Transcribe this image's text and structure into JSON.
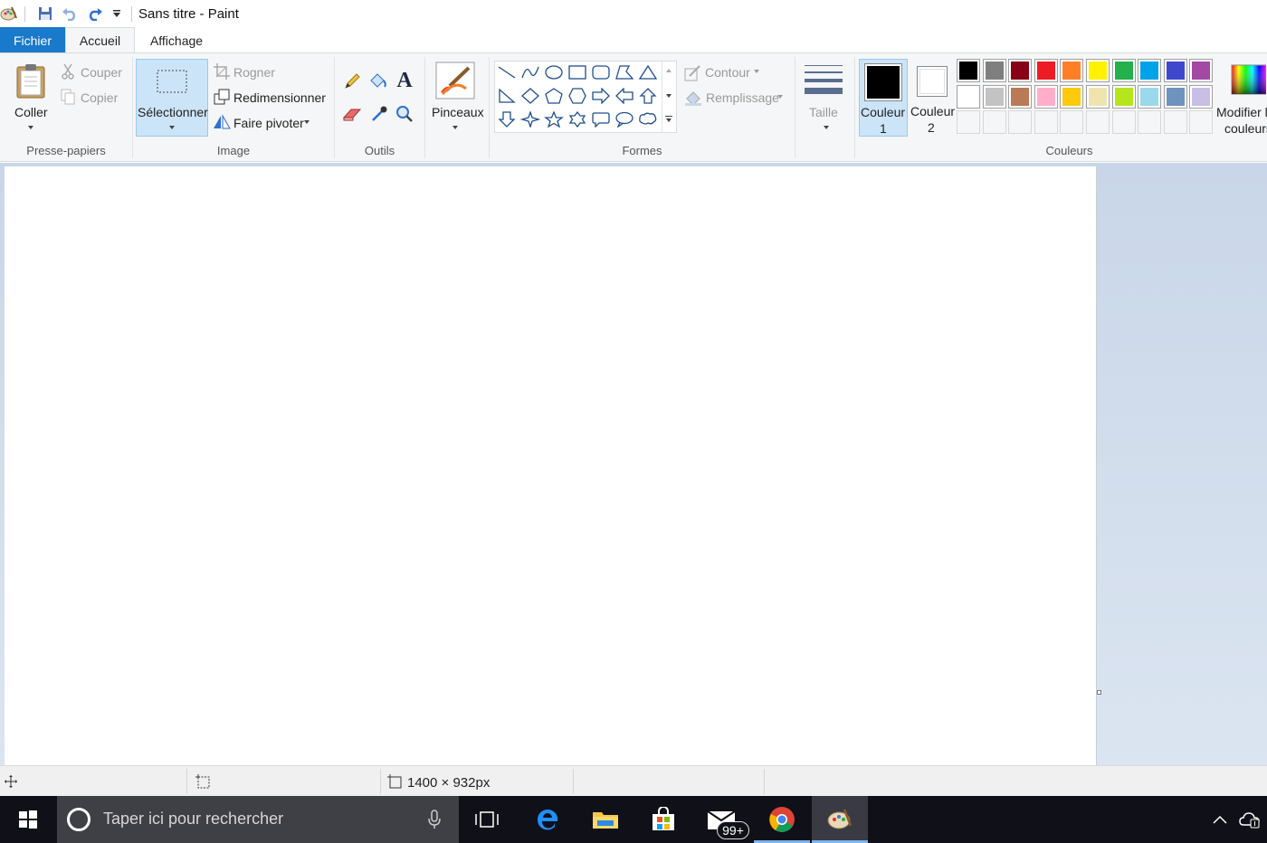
{
  "window": {
    "title": "Sans titre - Paint"
  },
  "quick_access": {
    "icons": [
      "paint-app-icon",
      "save-icon",
      "undo-icon",
      "redo-icon",
      "customize-dropdown-icon"
    ]
  },
  "tabs": [
    {
      "label": "Fichier",
      "active": false
    },
    {
      "label": "Accueil",
      "active": true
    },
    {
      "label": "Affichage",
      "active": false
    }
  ],
  "ribbon": {
    "clipboard": {
      "group_label": "Presse-papiers",
      "paste_label": "Coller",
      "cut_label": "Couper",
      "copy_label": "Copier"
    },
    "image": {
      "group_label": "Image",
      "select_label": "Sélectionner",
      "crop_label": "Rogner",
      "resize_label": "Redimensionner",
      "rotate_label": "Faire pivoter"
    },
    "tools": {
      "group_label": "Outils",
      "items": [
        "pencil-icon",
        "fill-bucket-icon",
        "text-tool-icon",
        "eraser-icon",
        "color-picker-icon",
        "magnifier-icon"
      ]
    },
    "brushes": {
      "label": "Pinceaux"
    },
    "shapes": {
      "group_label": "Formes",
      "outline_label": "Contour",
      "fill_label": "Remplissage",
      "items": [
        "line",
        "curve",
        "oval",
        "rectangle",
        "rounded-rectangle",
        "polygon",
        "triangle",
        "right-triangle",
        "diamond",
        "pentagon",
        "hexagon",
        "right-arrow",
        "left-arrow",
        "up-arrow",
        "down-arrow",
        "four-point-star",
        "five-point-star",
        "six-point-star",
        "rounded-callout",
        "oval-callout",
        "cloud-callout"
      ]
    },
    "size": {
      "label": "Taille"
    },
    "colors": {
      "group_label": "Couleurs",
      "color1_label": "Couleur",
      "color1_num": "1",
      "color2_label": "Couleur",
      "color2_num": "2",
      "color1_value": "#000000",
      "color2_value": "#ffffff",
      "palette_row1": [
        "#000000",
        "#7f7f7f",
        "#880015",
        "#ed1c24",
        "#ff7f27",
        "#fff200",
        "#22b14c",
        "#00a2e8",
        "#3f48cc",
        "#a349a4"
      ],
      "palette_row2": [
        "#ffffff",
        "#c3c3c3",
        "#b97a57",
        "#ffaec9",
        "#ffc90e",
        "#efe4b0",
        "#b5e61d",
        "#99d9ea",
        "#7092be",
        "#c8bfe7"
      ],
      "edit_label_1": "Modifier l",
      "edit_label_2": "couleurs"
    }
  },
  "status": {
    "size_text": "1400 × 932px"
  },
  "taskbar": {
    "search_placeholder": "Taper ici pour rechercher",
    "mail_badge": "99+"
  }
}
